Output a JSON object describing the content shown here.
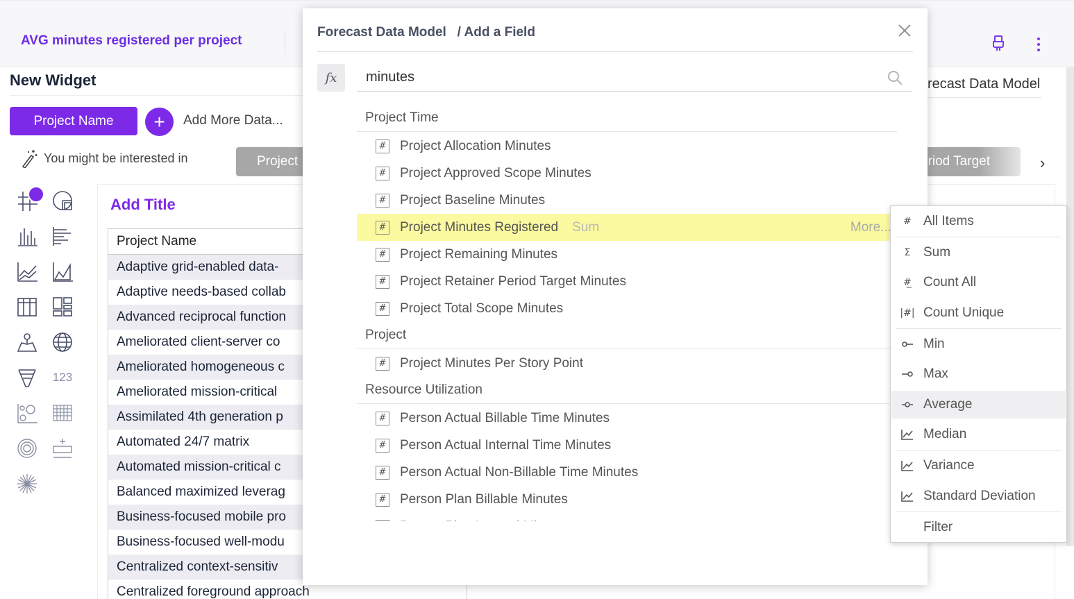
{
  "header": {
    "widget_title": "AVG minutes registered per project"
  },
  "builder": {
    "heading": "New Widget",
    "selected_chip": "Project Name",
    "add_more_label": "Add More Data...",
    "interested_label": "You might be interested in",
    "suggestion_left": "Project",
    "suggestion_right": "eriod Target",
    "right_model_label": "recast Data Model"
  },
  "icons": {
    "left_toolbar": [
      "table-icon",
      "pie-icon",
      "bar-chart-icon",
      "horizontal-bar-icon",
      "line-chart-icon",
      "area-chart-icon",
      "pivot-icon",
      "dashboard-icon",
      "map-icon",
      "globe-icon",
      "funnel-icon",
      "number-icon",
      "scatter-icon",
      "heatmap-icon",
      "target-icon",
      "gauge-icon",
      "sunburst-icon"
    ],
    "number_label": "123"
  },
  "canvas": {
    "add_title": "Add Title",
    "table": {
      "header": "Project Name",
      "rows": [
        "Adaptive grid-enabled data-",
        "Adaptive needs-based collab",
        "Advanced reciprocal function",
        "Ameliorated client-server co",
        "Ameliorated homogeneous c",
        "Ameliorated mission-critical",
        "Assimilated 4th generation p",
        "Automated 24/7 matrix",
        "Automated mission-critical c",
        "Balanced maximized leverag",
        "Business-focused mobile pro",
        "Business-focused well-modu",
        "Centralized context-sensitiv",
        "Centralized foreground approach"
      ]
    }
  },
  "modal": {
    "model_name": "Forecast Data Model",
    "crumb": "/ Add a Field",
    "fx_label": "fx",
    "search_value": "minutes",
    "groups": [
      {
        "name": "Project Time",
        "fields": [
          {
            "name": "Project Allocation Minutes"
          },
          {
            "name": "Project Approved Scope Minutes"
          },
          {
            "name": "Project Baseline Minutes"
          },
          {
            "name": "Project Minutes Registered",
            "agg": "Sum",
            "more": "More...",
            "highlighted": true
          },
          {
            "name": "Project Remaining Minutes"
          },
          {
            "name": "Project Retainer Period Target Minutes"
          },
          {
            "name": "Project Total Scope Minutes"
          }
        ]
      },
      {
        "name": "Project",
        "fields": [
          {
            "name": "Project Minutes Per Story Point"
          }
        ]
      },
      {
        "name": "Resource Utilization",
        "fields": [
          {
            "name": "Person Actual Billable Time Minutes"
          },
          {
            "name": "Person Actual Internal Time Minutes"
          },
          {
            "name": "Person Actual Non-Billable Time Minutes"
          },
          {
            "name": "Person Plan Billable Minutes"
          },
          {
            "name": "Person Plan Internal Minutes"
          }
        ]
      }
    ]
  },
  "agg_menu": {
    "items": [
      {
        "icon": "#",
        "label": "All Items"
      },
      {
        "icon": "Σ",
        "label": "Sum"
      },
      {
        "icon": "#̲",
        "label": "Count All"
      },
      {
        "icon": "|#|",
        "label": "Count Unique"
      },
      {
        "icon": "min-icon",
        "label": "Min"
      },
      {
        "icon": "max-icon",
        "label": "Max"
      },
      {
        "icon": "average-icon",
        "label": "Average",
        "active": true
      },
      {
        "icon": "median-icon",
        "label": "Median"
      },
      {
        "icon": "variance-icon",
        "label": "Variance"
      },
      {
        "icon": "stddev-icon",
        "label": "Standard Deviation"
      },
      {
        "icon": "",
        "label": "Filter"
      }
    ]
  },
  "colors": {
    "accent": "#7c2ae8",
    "highlight": "#fbfaa0",
    "chip_gray": "#a7a7a7"
  }
}
